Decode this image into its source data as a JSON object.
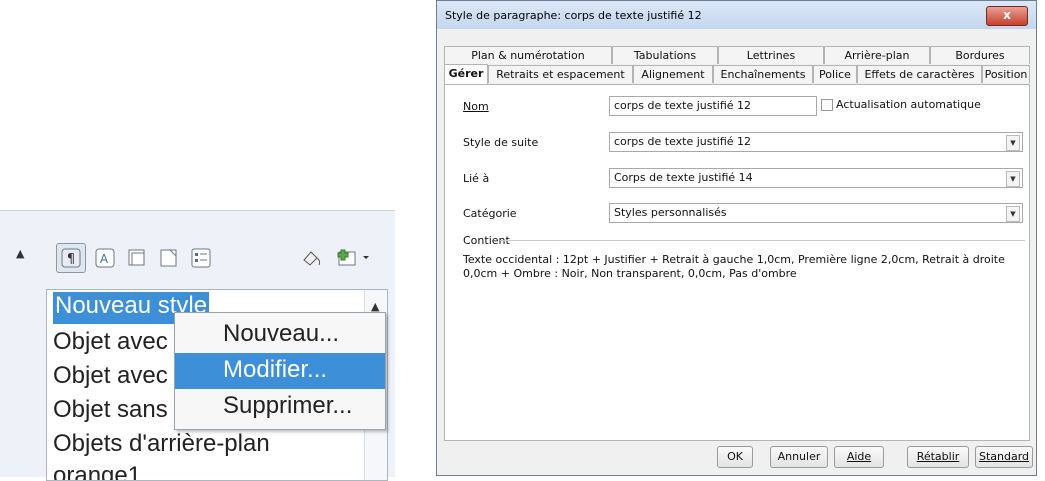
{
  "styles_panel": {
    "list_items": [
      "Nouveau style",
      "Objet avec",
      "Objet avec",
      "Objet sans",
      "Objets d'arrière-plan",
      "orange1"
    ],
    "selected_index": 0,
    "context_menu": {
      "items": [
        {
          "label": "Nouveau..."
        },
        {
          "label": "Modifier..."
        },
        {
          "label": "Supprimer..."
        }
      ],
      "active_index": 1
    },
    "toolbar_icons": [
      "paragraph-styles-icon",
      "character-styles-icon",
      "frame-styles-icon",
      "page-styles-icon",
      "list-styles-icon",
      "fill-format-icon",
      "new-style-icon"
    ]
  },
  "dialog": {
    "title": "Style de paragraphe: corps de texte justifié 12",
    "close_label": "x",
    "tabs_row1": [
      "Plan & numérotation",
      "Tabulations",
      "Lettrines",
      "Arrière-plan",
      "Bordures"
    ],
    "tabs_row2": [
      "Gérer",
      "Retraits et espacement",
      "Alignement",
      "Enchaînements",
      "Police",
      "Effets de caractères",
      "Position"
    ],
    "active_tab": "Gérer",
    "fields": {
      "nom_label": "Nom",
      "nom_value": "corps de texte justifié 12",
      "auto_update_label": "Actualisation automatique",
      "style_suite_label": "Style de suite",
      "style_suite_value": "corps de texte justifié 12",
      "lie_label": "Lié à",
      "lie_value": "Corps de texte justifié 14",
      "categorie_label": "Catégorie",
      "categorie_value": "Styles personnalisés"
    },
    "contient_label": "Contient",
    "contient_text": "Texte occidental : 12pt + Justifier + Retrait à gauche 1,0cm, Première ligne 2,0cm, Retrait à droite 0,0cm + Ombre : Noir, Non transparent, 0,0cm, Pas d'ombre",
    "buttons": [
      "OK",
      "Annuler",
      "Aide",
      "Rétablir",
      "Standard"
    ]
  },
  "colors": {
    "selection": "#3d8fd8",
    "close_button": "#c7402b",
    "title_bar": "#c4d7ee"
  }
}
